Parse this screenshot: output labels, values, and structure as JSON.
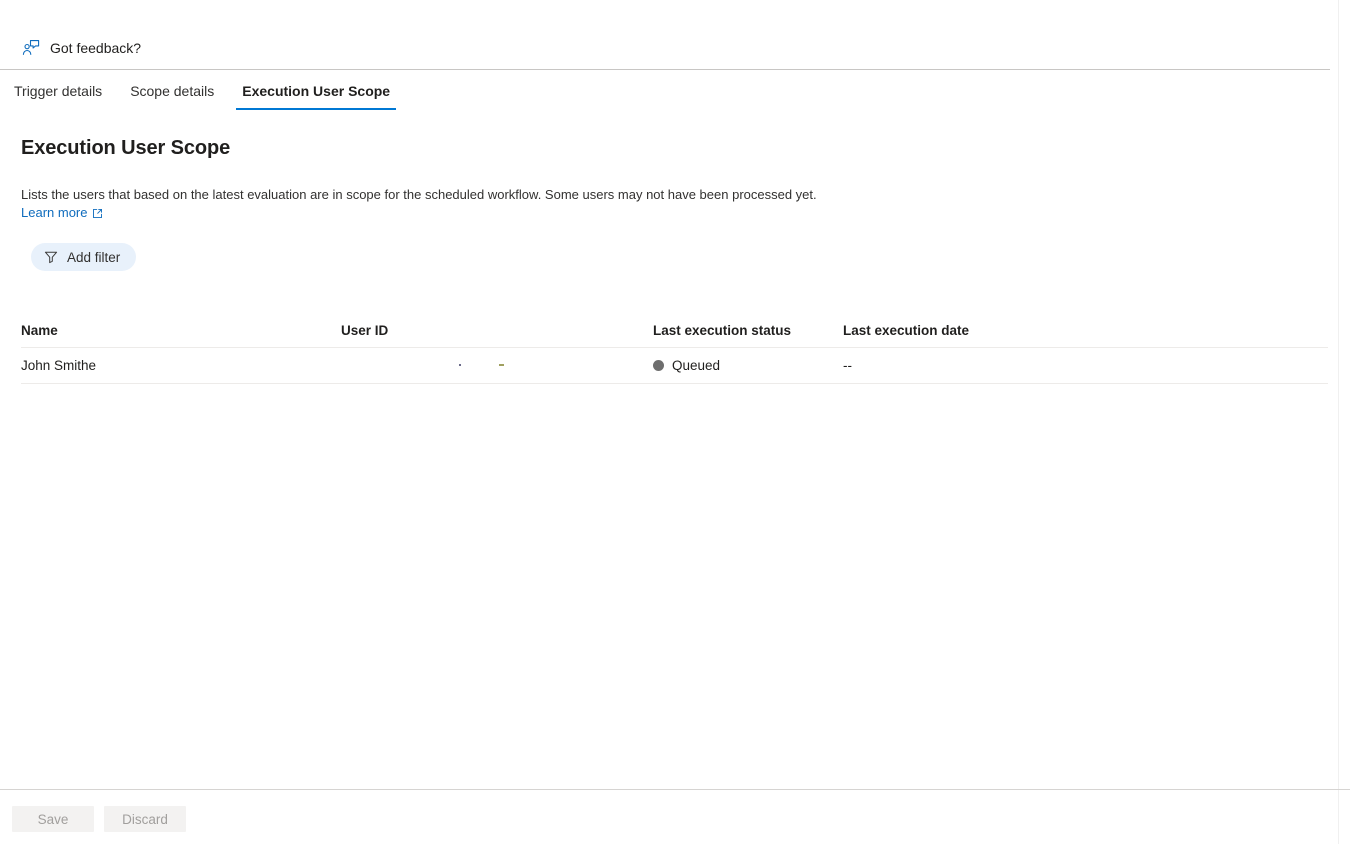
{
  "feedback": {
    "label": "Got feedback?",
    "icon": "feedback-person-icon"
  },
  "tabs": [
    {
      "label": "Trigger details",
      "active": false
    },
    {
      "label": "Scope details",
      "active": false
    },
    {
      "label": "Execution User Scope",
      "active": true
    }
  ],
  "section": {
    "title": "Execution User Scope",
    "description": "Lists the users that based on the latest evaluation are in scope for the scheduled workflow. Some users may not have been processed yet.",
    "learn_more_label": "Learn more",
    "learn_more_icon": "external-link-icon"
  },
  "toolbar": {
    "add_filter_label": "Add filter",
    "add_filter_icon": "filter-funnel-icon"
  },
  "table": {
    "columns": [
      "Name",
      "User ID",
      "Last execution status",
      "Last execution date"
    ],
    "rows": [
      {
        "name": "John Smithe",
        "user_id": "",
        "status": "Queued",
        "status_color": "#6e6e6e",
        "last_execution_date": "--"
      }
    ]
  },
  "footer": {
    "save_label": "Save",
    "discard_label": "Discard"
  },
  "colors": {
    "accent": "#0078d4",
    "link": "#0f6cbd",
    "filter_pill_bg": "#e8f1fb",
    "status_queued": "#6e6e6e"
  }
}
